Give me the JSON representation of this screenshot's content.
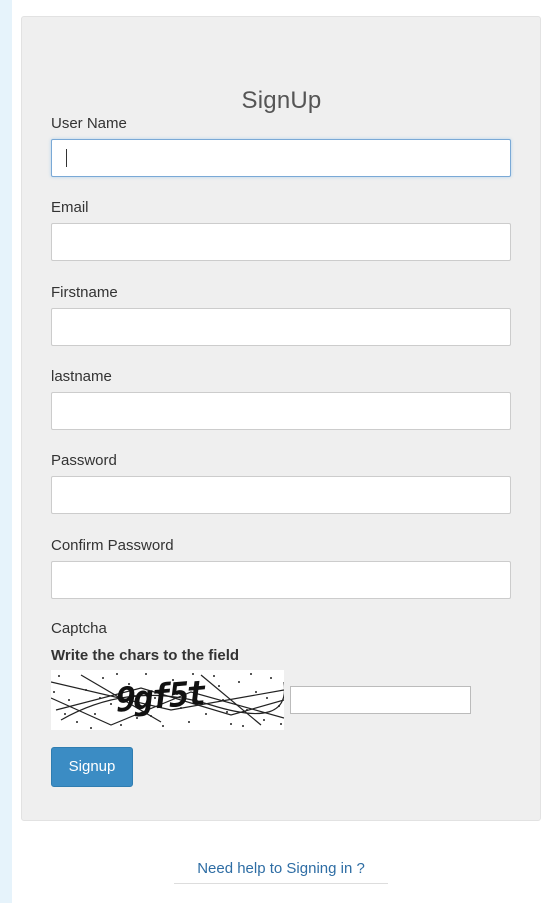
{
  "form": {
    "title": "SignUp",
    "fields": [
      {
        "label": "User Name",
        "value": "",
        "placeholder": ""
      },
      {
        "label": "Email",
        "value": "",
        "placeholder": ""
      },
      {
        "label": "Firstname",
        "value": "",
        "placeholder": ""
      },
      {
        "label": "lastname",
        "value": "",
        "placeholder": ""
      },
      {
        "label": "Password",
        "value": "",
        "placeholder": ""
      },
      {
        "label": "Confirm Password",
        "value": "",
        "placeholder": ""
      }
    ],
    "captcha": {
      "label": "Captcha",
      "instruction": "Write the chars to the field",
      "image_text": "9gf5t",
      "input_value": ""
    },
    "submit_label": "Signup"
  },
  "footer": {
    "help_link": "Need help to Signing in ?"
  },
  "colors": {
    "primary": "#3b8cc4",
    "link": "#2e6da4",
    "panel": "#efefef",
    "outer_bg": "#e6f3fb"
  }
}
